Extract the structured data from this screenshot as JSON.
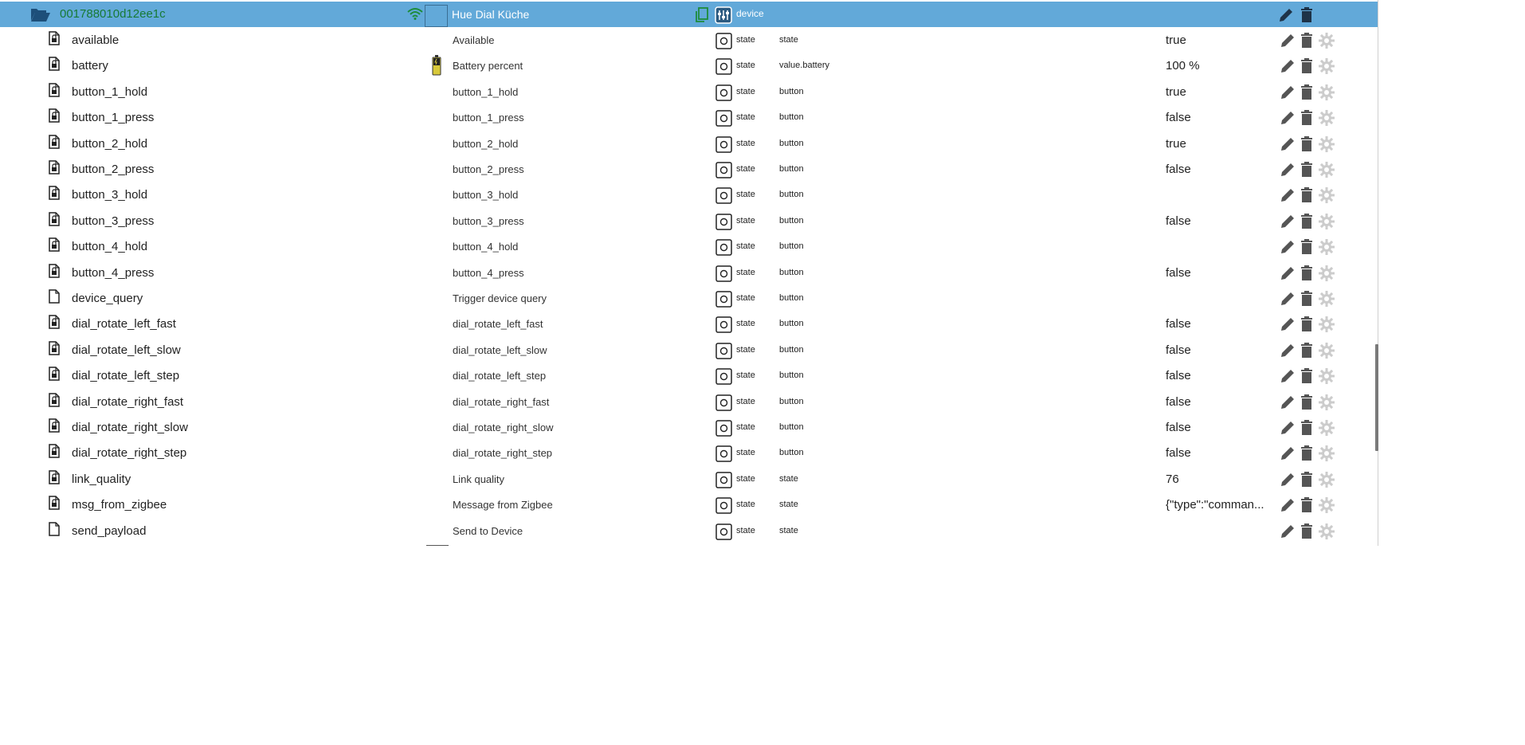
{
  "header": {
    "name": "001788010d12ee1c",
    "label": "Hue Dial Küche",
    "role": "device",
    "icons": [
      "folder-open-icon",
      "wifi-icon",
      "copy-icon",
      "device-icon",
      "pencil-icon",
      "trash-icon"
    ]
  },
  "rows": [
    {
      "name": "available",
      "label": "Available",
      "type": "state",
      "role": "state",
      "value": "true",
      "icon": "file-lock-icon"
    },
    {
      "name": "battery",
      "label": "Battery percent",
      "type": "state",
      "role": "value.battery",
      "value": "100 %",
      "icon": "file-lock-icon",
      "has_battery_icon": true
    },
    {
      "name": "button_1_hold",
      "label": "button_1_hold",
      "type": "state",
      "role": "button",
      "value": "true",
      "icon": "file-lock-icon"
    },
    {
      "name": "button_1_press",
      "label": "button_1_press",
      "type": "state",
      "role": "button",
      "value": "false",
      "icon": "file-lock-icon"
    },
    {
      "name": "button_2_hold",
      "label": "button_2_hold",
      "type": "state",
      "role": "button",
      "value": "true",
      "icon": "file-lock-icon"
    },
    {
      "name": "button_2_press",
      "label": "button_2_press",
      "type": "state",
      "role": "button",
      "value": "false",
      "icon": "file-lock-icon"
    },
    {
      "name": "button_3_hold",
      "label": "button_3_hold",
      "type": "state",
      "role": "button",
      "value": "",
      "icon": "file-lock-icon"
    },
    {
      "name": "button_3_press",
      "label": "button_3_press",
      "type": "state",
      "role": "button",
      "value": "false",
      "icon": "file-lock-icon"
    },
    {
      "name": "button_4_hold",
      "label": "button_4_hold",
      "type": "state",
      "role": "button",
      "value": "",
      "icon": "file-lock-icon"
    },
    {
      "name": "button_4_press",
      "label": "button_4_press",
      "type": "state",
      "role": "button",
      "value": "false",
      "icon": "file-lock-icon"
    },
    {
      "name": "device_query",
      "label": "Trigger device query",
      "type": "state",
      "role": "button",
      "value": "",
      "icon": "file-icon"
    },
    {
      "name": "dial_rotate_left_fast",
      "label": "dial_rotate_left_fast",
      "type": "state",
      "role": "button",
      "value": "false",
      "icon": "file-lock-icon"
    },
    {
      "name": "dial_rotate_left_slow",
      "label": "dial_rotate_left_slow",
      "type": "state",
      "role": "button",
      "value": "false",
      "icon": "file-lock-icon"
    },
    {
      "name": "dial_rotate_left_step",
      "label": "dial_rotate_left_step",
      "type": "state",
      "role": "button",
      "value": "false",
      "icon": "file-lock-icon"
    },
    {
      "name": "dial_rotate_right_fast",
      "label": "dial_rotate_right_fast",
      "type": "state",
      "role": "button",
      "value": "false",
      "icon": "file-lock-icon"
    },
    {
      "name": "dial_rotate_right_slow",
      "label": "dial_rotate_right_slow",
      "type": "state",
      "role": "button",
      "value": "false",
      "icon": "file-lock-icon"
    },
    {
      "name": "dial_rotate_right_step",
      "label": "dial_rotate_right_step",
      "type": "state",
      "role": "button",
      "value": "false",
      "icon": "file-lock-icon"
    },
    {
      "name": "link_quality",
      "label": "Link quality",
      "type": "state",
      "role": "state",
      "value": "76",
      "icon": "file-lock-icon"
    },
    {
      "name": "msg_from_zigbee",
      "label": "Message from Zigbee",
      "type": "state",
      "role": "state",
      "value": "{\"type\":\"comman...",
      "icon": "file-lock-icon"
    },
    {
      "name": "send_payload",
      "label": "Send to Device",
      "type": "state",
      "role": "state",
      "value": "",
      "icon": "file-icon"
    }
  ],
  "colors": {
    "header_bg": "#62a9d9",
    "header_name": "#177a35",
    "wifi": "#1d8c3a",
    "action_icon": "#555555",
    "gear_icon": "#cccccc"
  }
}
